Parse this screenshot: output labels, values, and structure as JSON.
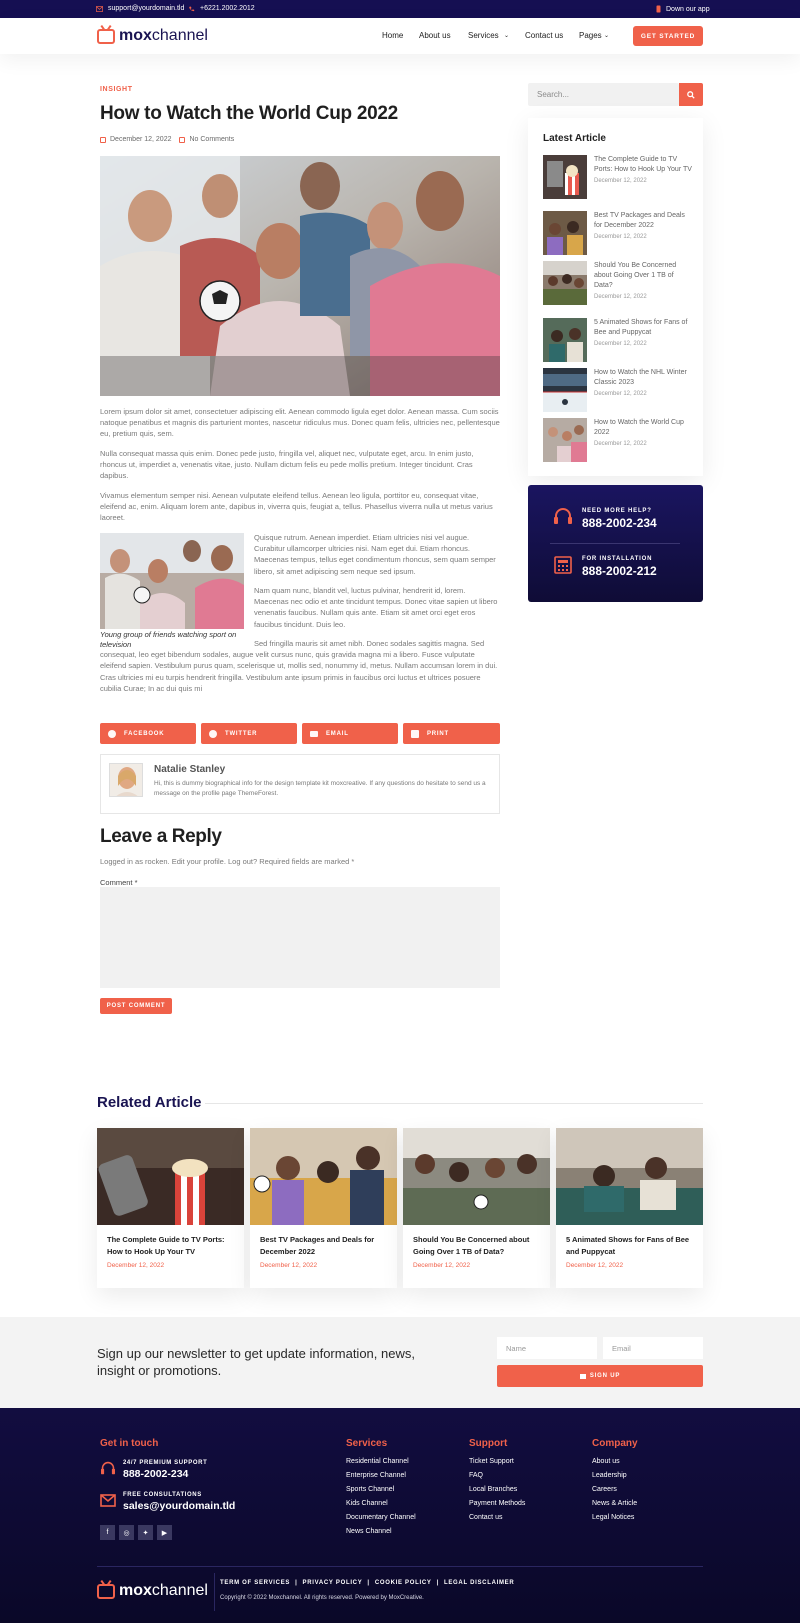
{
  "topbar": {
    "email": "support@yourdomain.tld",
    "phone": "+6221.2002.2012",
    "app": "Down our app"
  },
  "header": {
    "logo_bold": "mox",
    "logo_rest": "channel",
    "nav": [
      "Home",
      "About us",
      "Services",
      "Contact us",
      "Pages"
    ],
    "cta": "GET STARTED"
  },
  "article": {
    "category": "INSIGHT",
    "title": "How to Watch the World Cup 2022",
    "date": "December 12, 2022",
    "comments": "No Comments",
    "paragraphs": [
      "Lorem ipsum dolor sit amet, consectetuer adipiscing elit. Aenean commodo ligula eget dolor. Aenean massa. Cum sociis natoque penatibus et magnis dis parturient montes, nascetur ridiculus mus. Donec quam felis, ultricies nec, pellentesque eu, pretium quis, sem.",
      "Nulla consequat massa quis enim. Donec pede justo, fringilla vel, aliquet nec, vulputate eget, arcu. In enim justo, rhoncus ut, imperdiet a, venenatis vitae, justo. Nullam dictum felis eu pede mollis pretium. Integer tincidunt. Cras dapibus.",
      "Vivamus elementum semper nisi. Aenean vulputate eleifend tellus. Aenean leo ligula, porttitor eu, consequat vitae, eleifend ac, enim. Aliquam lorem ante, dapibus in, viverra quis, feugiat a, tellus. Phasellus viverra nulla ut metus varius laoreet."
    ],
    "float_paragraphs": [
      "Quisque rutrum. Aenean imperdiet. Etiam ultricies nisi vel augue. Curabitur ullamcorper ultricies nisi. Nam eget dui. Etiam rhoncus. Maecenas tempus, tellus eget condimentum rhoncus, sem quam semper libero, sit amet adipiscing sem neque sed ipsum.",
      "Nam quam nunc, blandit vel, luctus pulvinar, hendrerit id, lorem. Maecenas nec odio et ante tincidunt tempus. Donec vitae sapien ut libero venenatis faucibus. Nullam quis ante. Etiam sit amet orci eget eros faucibus tincidunt. Duis leo.",
      "Sed fringilla mauris sit amet nibh. Donec sodales sagittis magna. Sed consequat, leo eget bibendum sodales, augue velit cursus nunc, quis gravida magna mi a libero. Fusce vulputate eleifend sapien. Vestibulum purus quam, scelerisque ut, mollis sed, nonummy id, metus. Nullam accumsan lorem in dui. Cras ultricies mi eu turpis hendrerit fringilla. Vestibulum ante ipsum primis in faucibus orci luctus et ultrices posuere cubilia Curae; In ac dui quis mi"
    ],
    "caption": "Young group of friends watching sport on television",
    "share": [
      "FACEBOOK",
      "TWITTER",
      "EMAIL",
      "PRINT"
    ],
    "author": {
      "name": "Natalie Stanley",
      "bio": "Hi, this is dummy biographical info for the design template kit moxcreative. If any questions do hesitate to send us a message on the profile page ThemeForest."
    },
    "reply": {
      "title": "Leave a Reply",
      "logged": "Logged in as rocken. Edit your profile. Log out? Required fields are marked *",
      "comment_label": "Comment *",
      "submit": "POST COMMENT"
    }
  },
  "sidebar": {
    "search_placeholder": "Search...",
    "latest_title": "Latest Article",
    "latest": [
      {
        "title": "The Complete Guide to TV Ports: How to Hook Up Your TV",
        "date": "December 12, 2022"
      },
      {
        "title": "Best TV Packages and Deals for December 2022",
        "date": "December 12, 2022"
      },
      {
        "title": "Should You Be Concerned about Going Over 1 TB of Data?",
        "date": "December 12, 2022"
      },
      {
        "title": "5 Animated Shows for Fans of Bee and Puppycat",
        "date": "December 12, 2022"
      },
      {
        "title": "How to Watch the NHL Winter Classic 2023",
        "date": "December 12, 2022"
      },
      {
        "title": "How to Watch the World Cup 2022",
        "date": "December 12, 2022"
      }
    ],
    "help": [
      {
        "label": "NEED MORE HELP?",
        "number": "888-2002-234"
      },
      {
        "label": "FOR INSTALLATION",
        "number": "888-2002-212"
      }
    ]
  },
  "related": {
    "title": "Related Article",
    "items": [
      {
        "title": "The Complete Guide to TV Ports: How to Hook Up Your TV",
        "date": "December 12, 2022"
      },
      {
        "title": "Best TV Packages and Deals for December 2022",
        "date": "December 12, 2022"
      },
      {
        "title": "Should You Be Concerned about Going Over 1 TB of Data?",
        "date": "December 12, 2022"
      },
      {
        "title": "5 Animated Shows for Fans of Bee and Puppycat",
        "date": "December 12, 2022"
      }
    ]
  },
  "newsletter": {
    "text": "Sign up our newsletter to get update information, news, insight or promotions.",
    "name_placeholder": "Name",
    "email_placeholder": "Email",
    "button": "SIGN UP"
  },
  "footer": {
    "touch_title": "Get in touch",
    "support_label": "24/7 PREMIUM SUPPORT",
    "support_number": "888-2002-234",
    "consult_label": "FREE CONSULTATIONS",
    "consult_email": "sales@yourdomain.tld",
    "columns": [
      {
        "title": "Services",
        "links": [
          "Residential Channel",
          "Enterprise Channel",
          "Sports Channel",
          "Kids Channel",
          "Documentary Channel",
          "News Channel"
        ]
      },
      {
        "title": "Support",
        "links": [
          "Ticket Support",
          "FAQ",
          "Local Branches",
          "Payment Methods",
          "Contact us"
        ]
      },
      {
        "title": "Company",
        "links": [
          "About us",
          "Leadership",
          "Careers",
          "News & Article",
          "Legal Notices"
        ]
      }
    ],
    "legal_links": [
      "TERM OF SERVICES",
      "PRIVACY POLICY",
      "COOKIE POLICY",
      "LEGAL DISCLAIMER"
    ],
    "copyright": "Copyright © 2022 Moxchannel. All rights reserved. Powered by MoxCreative."
  },
  "colors": {
    "accent": "#f0614a",
    "navy": "#150f52"
  }
}
